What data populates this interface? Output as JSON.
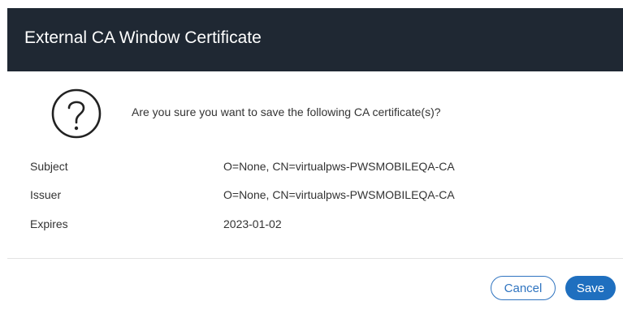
{
  "dialog": {
    "title": "External CA Window Certificate",
    "icon": "question-circle-icon",
    "prompt": "Are you sure you want to save the following CA certificate(s)?",
    "details": [
      {
        "label": "Subject",
        "value": "O=None, CN=virtualpws-PWSMOBILEQA-CA"
      },
      {
        "label": "Issuer",
        "value": "O=None, CN=virtualpws-PWSMOBILEQA-CA"
      },
      {
        "label": "Expires",
        "value": "2023-01-02"
      }
    ],
    "buttons": {
      "cancel_label": "Cancel",
      "save_label": "Save"
    }
  },
  "colors": {
    "header_bg": "#1f2833",
    "accent": "#1f6fbf"
  }
}
